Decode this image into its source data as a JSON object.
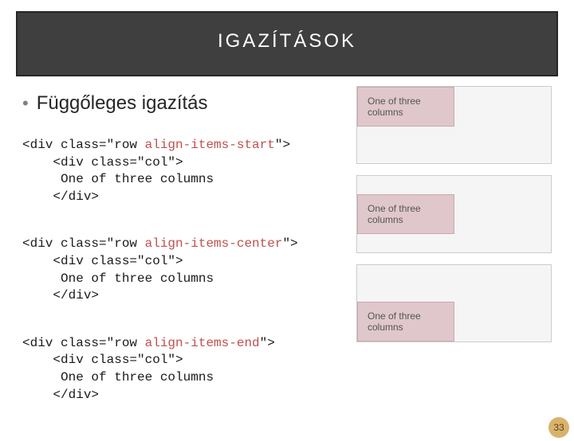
{
  "title": "IGAZÍTÁSOK",
  "bullet": "Függőleges igazítás",
  "code": {
    "start": {
      "line1_a": "<div class=\"row ",
      "line1_b": "align-items-start",
      "line1_c": "\">",
      "line2": "    <div class=\"col\">",
      "line3": "     One of three columns",
      "line4": "    </div>"
    },
    "center": {
      "line1_a": "<div class=\"row ",
      "line1_b": "align-items-center",
      "line1_c": "\">",
      "line2": "    <div class=\"col\">",
      "line3": "     One of three columns",
      "line4": "    </div>"
    },
    "end": {
      "line1_a": "<div class=\"row ",
      "line1_b": "align-items-end",
      "line1_c": "\">",
      "line2": "    <div class=\"col\">",
      "line3": "     One of three columns",
      "line4": "    </div>"
    }
  },
  "demo_label": "One of three columns",
  "page_number": "33"
}
